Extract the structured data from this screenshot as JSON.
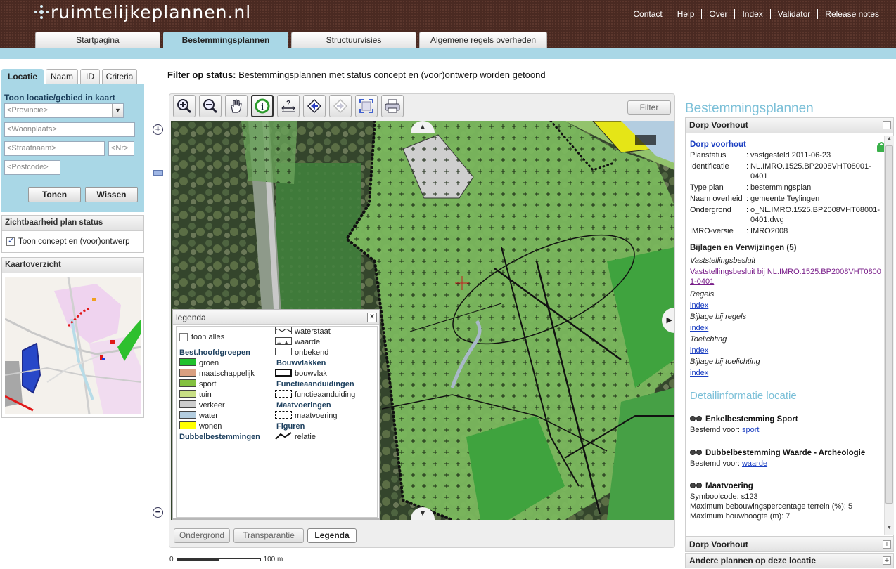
{
  "header": {
    "logo_text": "ruimtelijkeplannen.nl",
    "top_links": [
      "Contact",
      "Help",
      "Over",
      "Index",
      "Validator",
      "Release notes"
    ],
    "tabs": [
      {
        "label": "Startpagina",
        "active": false
      },
      {
        "label": "Bestemmingsplannen",
        "active": true
      },
      {
        "label": "Structuurvisies",
        "active": false
      },
      {
        "label": "Algemene regels overheden",
        "active": false
      }
    ]
  },
  "left": {
    "tabs": [
      {
        "label": "Locatie",
        "active": true
      },
      {
        "label": "Naam",
        "active": false
      },
      {
        "label": "ID",
        "active": false
      },
      {
        "label": "Criteria",
        "active": false
      }
    ],
    "location_title": "Toon locatie/gebied in kaart",
    "province_placeholder": "<Provincie>",
    "woonplaats_placeholder": "<Woonplaats>",
    "straatnaam_placeholder": "<Straatnaam>",
    "nr_placeholder": "<Nr>",
    "postcode_placeholder": "<Postcode>",
    "tonen_label": "Tonen",
    "wissen_label": "Wissen",
    "visibility_title": "Zichtbaarheid plan status",
    "visibility_checkbox_label": "Toon concept en (voor)ontwerp",
    "visibility_checked": true,
    "overview_title": "Kaartoverzicht"
  },
  "filter": {
    "label": "Filter op status:",
    "text": " Bestemmingsplannen met status concept en (voor)ontwerp worden getoond",
    "button": "Filter"
  },
  "toolbar": {
    "tools": [
      "zoom-in-icon",
      "zoom-out-icon",
      "pan-hand-icon",
      "info-icon",
      "measure-icon",
      "previous-extent-icon",
      "next-extent-icon",
      "full-extent-icon",
      "print-icon"
    ],
    "active_tool": "info-icon"
  },
  "legend": {
    "title": "legenda",
    "show_all": "toon alles",
    "col1": {
      "group1": "Best.hoofdgroepen",
      "items": [
        {
          "label": "groen",
          "color": "#21c12d"
        },
        {
          "label": "maatschappelijk",
          "color": "#d99f80"
        },
        {
          "label": "sport",
          "color": "#83c140"
        },
        {
          "label": "tuin",
          "color": "#c8df85"
        },
        {
          "label": "verkeer",
          "color": "#cdcdcd"
        },
        {
          "label": "water",
          "color": "#b3cde0"
        },
        {
          "label": "wonen",
          "color": "#ffff00"
        }
      ],
      "group2": "Dubbelbestemmingen"
    },
    "col2": {
      "items_top": [
        {
          "label": "waterstaat",
          "pattern": "wave"
        },
        {
          "label": "waarde",
          "pattern": "plus"
        },
        {
          "label": "onbekend",
          "pattern": "empty"
        }
      ],
      "group_bouwvlakken": "Bouwvlakken",
      "bouwvlak": "bouwvlak",
      "group_functie": "Functieaanduidingen",
      "functieaanduiding": "functieaanduiding",
      "group_maat": "Maatvoeringen",
      "maatvoering": "maatvoering",
      "group_figuren": "Figuren",
      "relatie": "relatie"
    }
  },
  "map_buttons": [
    {
      "label": "Ondergrond",
      "active": false
    },
    {
      "label": "Transparantie",
      "active": false
    },
    {
      "label": "Legenda",
      "active": true
    }
  ],
  "scale": {
    "start": "0",
    "end": "100 m"
  },
  "right": {
    "title": "Bestemmingsplannen",
    "section1_header": "Dorp Voorhout",
    "plan_link": "Dorp voorhout",
    "props": [
      {
        "key": "Planstatus",
        "value": "vastgesteld 2011-06-23"
      },
      {
        "key": "Identificatie",
        "value": "NL.IMRO.1525.BP2008VHT08001-0401"
      },
      {
        "key": "Type plan",
        "value": "bestemmingsplan"
      },
      {
        "key": "Naam overheid",
        "value": "gemeente Teylingen"
      },
      {
        "key": "Ondergrond",
        "value": "o_NL.IMRO.1525.BP2008VHT08001-0401.dwg"
      },
      {
        "key": "IMRO-versie",
        "value": "IMRO2008"
      }
    ],
    "attachments_title": "Bijlagen en Verwijzingen (5)",
    "attachments": [
      {
        "label": "Vaststellingsbesluit",
        "link": "Vaststellingsbesluit bij NL.IMRO.1525.BP2008VHT08001-0401"
      },
      {
        "label": "Regels",
        "link": "index"
      },
      {
        "label": "Bijlage bij regels",
        "link": "index"
      },
      {
        "label": "Toelichting",
        "link": "index"
      },
      {
        "label": "Bijlage bij toelichting",
        "link": "index"
      }
    ],
    "detail_title": "Detailinformatie locatie",
    "details": [
      {
        "title": "Enkelbestemming Sport",
        "lines": [
          {
            "prefix": "Bestemd voor: ",
            "link": "sport"
          }
        ]
      },
      {
        "title": "Dubbelbestemming Waarde - Archeologie",
        "lines": [
          {
            "prefix": "Bestemd voor: ",
            "link": "waarde"
          }
        ]
      },
      {
        "title": "Maatvoering",
        "lines": [
          {
            "text": "Symboolcode: s123"
          },
          {
            "text": "Maximum bebouwingspercentage terrein (%): 5"
          },
          {
            "text": "Maximum bouwhoogte (m): 7"
          }
        ]
      }
    ],
    "footer1": "Dorp Voorhout",
    "footer2": "Andere plannen op deze locatie"
  }
}
